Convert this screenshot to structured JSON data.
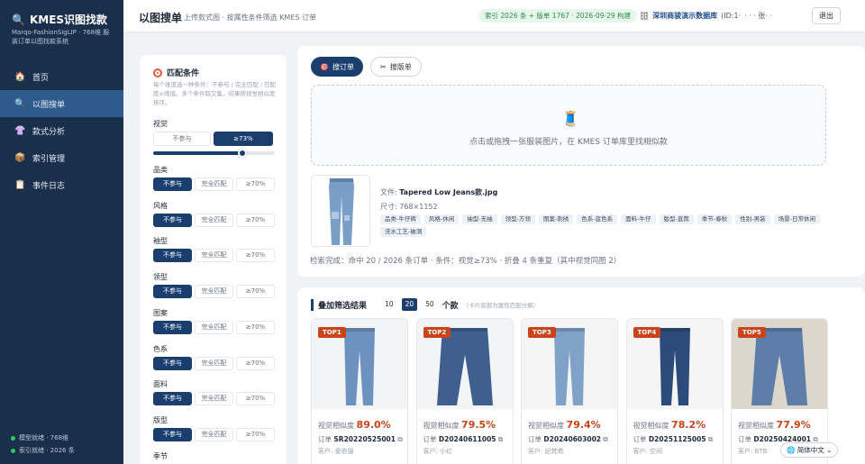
{
  "sidebar": {
    "brand": "KMES识图找款",
    "brand_sub": "Marqo-FashionSigLIP · 768维 服装订单以图找款系统",
    "items": [
      {
        "label": "首页",
        "icon": "house-icon"
      },
      {
        "label": "以图搜单",
        "icon": "search-icon"
      },
      {
        "label": "款式分析",
        "icon": "shirt-icon"
      },
      {
        "label": "索引管理",
        "icon": "box-icon"
      },
      {
        "label": "事件日志",
        "icon": "clipboard-icon"
      }
    ],
    "status": [
      "模型就绪 · 768维",
      "索引就绪 · 2026 条"
    ],
    "status_color": "#34c759"
  },
  "header": {
    "title": "以图搜单",
    "subtitle": "上传款式图 · 按属性条件筛选 KMES 订单",
    "index_info": "索引 2026 条 + 版单 1767 · 2026-09-29 构建",
    "db_name": "深圳商骏演示数据库",
    "db_id": "(ID:1·",
    "user": "·  ·  ·  张·  ·",
    "logout": "退出"
  },
  "filter": {
    "title": "匹配条件",
    "desc": "每个维度选一种条件：不参与 / 完全匹配 / 匹配度≥阈值。多个条件取交集，结果按视觉相似度排序。",
    "visual": {
      "label": "视觉",
      "off": "不参与",
      "value": "≥73%",
      "slider": 0.73
    },
    "options": {
      "skip": "不参与",
      "exact": "完全匹配",
      "threshold": "≥70%"
    },
    "attributes": [
      "品类",
      "风格",
      "袖型",
      "领型",
      "图案",
      "色系",
      "面料",
      "版型",
      "季节"
    ]
  },
  "search": {
    "tabs": [
      "搜订单",
      "搜版单"
    ],
    "drop_text": "点击或拖拽一张服装图片，在 KMES 订单库里找相似款",
    "file_label": "文件:",
    "file_name": "Tapered Low Jeans款.jpg",
    "size_label": "尺寸:",
    "size": "768×1152",
    "tags": [
      "品类-牛仔裤",
      "风格-休闲",
      "袖型-无袖",
      "领型-方领",
      "图案-刺绣",
      "色系-蓝色系",
      "面料-牛仔",
      "版型-直筒",
      "季节-春秋",
      "性别-男装",
      "场景-日常休闲",
      "洗水工艺-破洞"
    ],
    "result_line": "检索完成：命中 20 / 2026 条订单 · 条件：视觉≥73% · 折叠 4 条重复（其中视觉同图 2）"
  },
  "results": {
    "title": "叠加筛选结果",
    "counts": [
      "10",
      "20",
      "50"
    ],
    "selected_count": "20",
    "unit": "个款",
    "note": "（卡片底部为属性匹配分解）",
    "sim_label": "视觉相似度",
    "order_label": "订单",
    "cust_label": "客户:",
    "cards": [
      {
        "rank": "TOP1",
        "sim": "89.0%",
        "order": "SR20220525001",
        "customer": "爱依服"
      },
      {
        "rank": "TOP2",
        "sim": "79.5%",
        "order": "D20240611005",
        "customer": "小红"
      },
      {
        "rank": "TOP3",
        "sim": "79.4%",
        "order": "D20240603002",
        "customer": "妃梵希"
      },
      {
        "rank": "TOP4",
        "sim": "78.2%",
        "order": "D20251125005",
        "customer": "空间"
      },
      {
        "rank": "TOP5",
        "sim": "77.9%",
        "order": "D20250424001",
        "customer": "BTB"
      }
    ]
  },
  "language": "简体中文"
}
